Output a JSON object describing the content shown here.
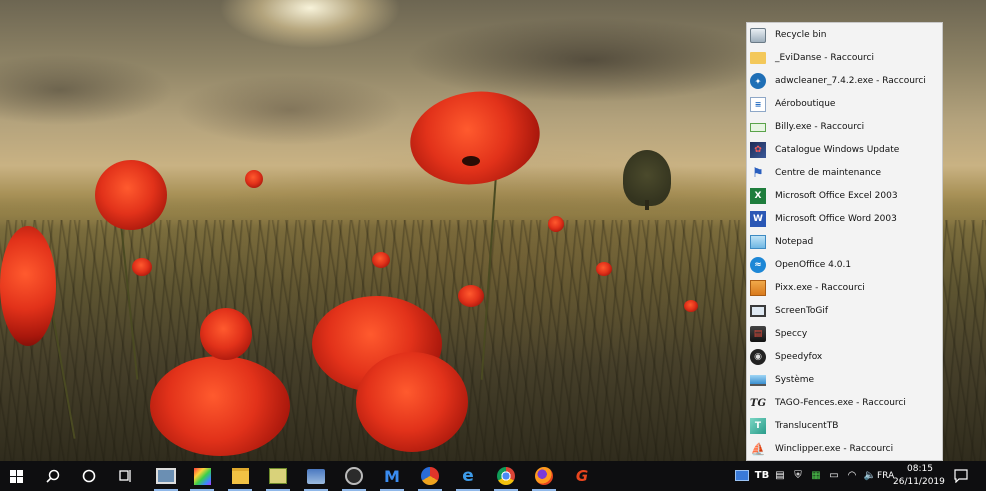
{
  "desktop": {
    "wallpaper": "poppy-field-sunset"
  },
  "fence": {
    "items": [
      {
        "label": "Recycle bin",
        "icon": "recycle-bin-icon"
      },
      {
        "label": "_EviDanse - Raccourci",
        "icon": "folder-icon"
      },
      {
        "label": "adwcleaner_7.4.2.exe - Raccourci",
        "icon": "adwcleaner-icon"
      },
      {
        "label": "Aéroboutique",
        "icon": "document-icon"
      },
      {
        "label": "Billy.exe - Raccourci",
        "icon": "billy-icon"
      },
      {
        "label": "Catalogue Windows Update",
        "icon": "windows-update-catalog-icon"
      },
      {
        "label": "Centre de maintenance",
        "icon": "flag-icon"
      },
      {
        "label": "Microsoft Office Excel 2003",
        "icon": "excel-icon"
      },
      {
        "label": "Microsoft Office Word 2003",
        "icon": "word-icon"
      },
      {
        "label": "Notepad",
        "icon": "notepad-icon"
      },
      {
        "label": "OpenOffice 4.0.1",
        "icon": "openoffice-icon"
      },
      {
        "label": "Pixx.exe - Raccourci",
        "icon": "pixx-icon"
      },
      {
        "label": "ScreenToGif",
        "icon": "monitor-icon"
      },
      {
        "label": "Speccy",
        "icon": "speccy-icon"
      },
      {
        "label": "Speedyfox",
        "icon": "speedyfox-icon"
      },
      {
        "label": "Système",
        "icon": "system-laptop-icon"
      },
      {
        "label": "TAGO-Fences.exe - Raccourci",
        "icon": "tago-fences-icon"
      },
      {
        "label": "TranslucentTB",
        "icon": "translucenttb-icon"
      },
      {
        "label": "Winclipper.exe - Raccourci",
        "icon": "winclipper-icon"
      }
    ]
  },
  "taskbar": {
    "start_icon": "windows-logo-icon",
    "search_icon": "search-icon",
    "cortana_icon": "cortana-circle-icon",
    "taskview_icon": "task-view-icon",
    "apps": [
      {
        "name": "screen-app",
        "icon": "screen-capture-icon"
      },
      {
        "name": "color-app",
        "icon": "color-palette-icon"
      },
      {
        "name": "file-explorer",
        "icon": "file-explorer-icon"
      },
      {
        "name": "green-app",
        "icon": "green-app-icon"
      },
      {
        "name": "photo-app",
        "icon": "photo-viewer-icon"
      },
      {
        "name": "speedyfox-app",
        "icon": "speedyfox-icon"
      },
      {
        "name": "malwarebytes",
        "icon": "malwarebytes-icon"
      },
      {
        "name": "ccleaner",
        "icon": "ccleaner-icon"
      },
      {
        "name": "edge",
        "icon": "edge-icon"
      },
      {
        "name": "chrome",
        "icon": "chrome-icon"
      },
      {
        "name": "firefox",
        "icon": "firefox-icon"
      },
      {
        "name": "tago-app",
        "icon": "tago-g-icon"
      }
    ],
    "tray": {
      "language": "FRA",
      "time": "08:15",
      "date": "26/11/2019",
      "notification_icon": "action-center-icon"
    }
  }
}
